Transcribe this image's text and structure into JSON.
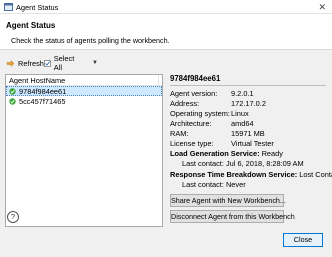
{
  "window": {
    "title": "Agent Status"
  },
  "header": {
    "title": "Agent Status",
    "description": "Check the status of agents polling the workbench."
  },
  "toolbar": {
    "refresh_label": "Refresh",
    "select_all_label": "Select All"
  },
  "agent_list": {
    "column_header": "Agent HostName",
    "rows": [
      {
        "host": "9784f984ee61",
        "selected": true
      },
      {
        "host": "5cc457f71465",
        "selected": false
      }
    ]
  },
  "details": {
    "name": "9784f984ee61",
    "fields": [
      {
        "label": "Agent version:",
        "value": "9.2.0.1"
      },
      {
        "label": "Address:",
        "value": "172.17.0.2"
      },
      {
        "label": "Operating system:",
        "value": "Linux"
      },
      {
        "label": "Architecture:",
        "value": "amd64"
      },
      {
        "label": "RAM:",
        "value": "15971 MB"
      },
      {
        "label": "License type:",
        "value": "Virtual Tester"
      }
    ],
    "load_generation": {
      "label": "Load Generation Service:",
      "status": "Ready",
      "last_contact": "Last contact: Jul 6, 2018, 8:28:09 AM"
    },
    "response_time": {
      "label": "Response Time Breakdown Service:",
      "status": "Lost Contact",
      "last_contact": "Last contact: Never"
    },
    "share_button": "Share Agent with New Workbench...",
    "disconnect_button": "Disconnect Agent from this Workbench"
  },
  "footer": {
    "help_label": "?",
    "close_label": "Close"
  },
  "colors": {
    "selection": "#cde8ff",
    "status_ok": "#3aa53a",
    "accent": "#0078d7"
  }
}
